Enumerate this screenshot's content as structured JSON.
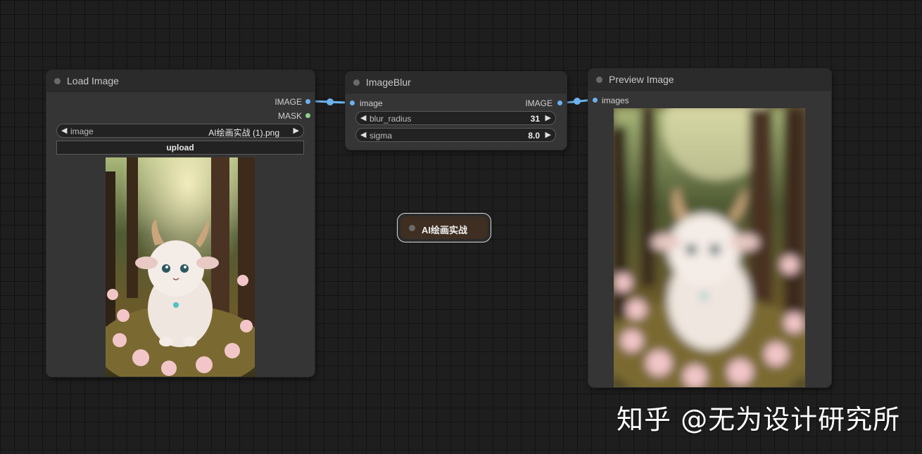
{
  "nodes": {
    "load_image": {
      "title": "Load Image",
      "outputs": [
        "IMAGE",
        "MASK"
      ],
      "image_widget": {
        "label": "image",
        "value": "AI绘画实战 (1).png"
      },
      "upload_label": "upload"
    },
    "image_blur": {
      "title": "ImageBlur",
      "input": "image",
      "output": "IMAGE",
      "widgets": [
        {
          "label": "blur_radius",
          "value": "31"
        },
        {
          "label": "sigma",
          "value": "8.0"
        }
      ]
    },
    "preview_image": {
      "title": "Preview Image",
      "input": "images"
    }
  },
  "group": {
    "label": "AI绘画实战"
  },
  "watermark": "知乎 @无为设计研究所",
  "colors": {
    "image_slot": "#6cb2ef",
    "mask_slot": "#8bd38b",
    "wire": "#6cb2ef",
    "group_fill": "#3e2f22"
  },
  "icons": {
    "left_arrow": "◀",
    "right_arrow": "▶"
  }
}
